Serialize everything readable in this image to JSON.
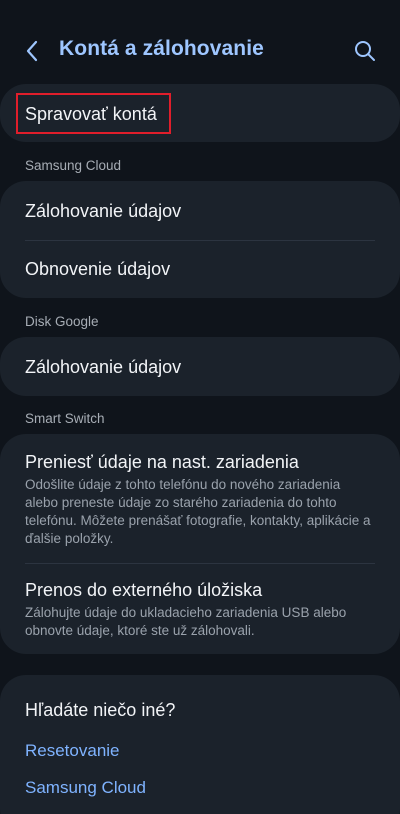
{
  "header": {
    "title": "Kontá a zálohovanie",
    "back_icon": "chevron-left-icon",
    "search_icon": "search-icon"
  },
  "accounts": {
    "manage_label": "Spravovať kontá"
  },
  "samsung_cloud": {
    "section_label": "Samsung Cloud",
    "items": [
      {
        "title": "Zálohovanie údajov"
      },
      {
        "title": "Obnovenie údajov"
      }
    ]
  },
  "google_drive": {
    "section_label": "Disk Google",
    "items": [
      {
        "title": "Zálohovanie údajov"
      }
    ]
  },
  "smart_switch": {
    "section_label": "Smart Switch",
    "items": [
      {
        "title": "Preniesť údaje na nast. zariadenia",
        "description": "Odošlite údaje z tohto telefónu do nového zariadenia alebo preneste údaje zo starého zariadenia do tohto telefónu. Môžete prenášať fotografie, kontakty, aplikácie a ďalšie položky."
      },
      {
        "title": "Prenos do externého úložiska",
        "description": "Zálohujte údaje do ukladacieho zariadenia USB alebo obnovte údaje, ktoré ste už zálohovali."
      }
    ]
  },
  "looking_for": {
    "title": "Hľadáte niečo iné?",
    "links": [
      "Resetovanie",
      "Samsung Cloud"
    ]
  },
  "colors": {
    "background": "#0f141b",
    "card": "#1b222b",
    "accent": "#9ec6ff",
    "link": "#7fb3ff",
    "highlight": "#e01e2b"
  }
}
